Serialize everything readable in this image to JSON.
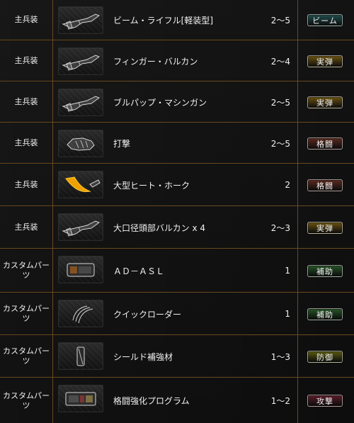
{
  "rows": [
    {
      "category": "主兵装",
      "name": "ビーム・ライフル[軽装型]",
      "range": "2～5",
      "type": "ビーム",
      "type_color": "#1f4d4c",
      "icon": "beam-rifle-icon"
    },
    {
      "category": "主兵装",
      "name": "フィンガー・バルカン",
      "range": "2～4",
      "type": "実弾",
      "type_color": "#6a5210",
      "icon": "finger-vulcan-icon"
    },
    {
      "category": "主兵装",
      "name": "ブルパップ・マシンガン",
      "range": "2～5",
      "type": "実弾",
      "type_color": "#6a5210",
      "icon": "bullpup-machine-gun-icon"
    },
    {
      "category": "主兵装",
      "name": "打撃",
      "range": "2～5",
      "type": "格闘",
      "type_color": "#5a2a1e",
      "icon": "fist-strike-icon"
    },
    {
      "category": "主兵装",
      "name": "大型ヒート・ホーク",
      "range": "2",
      "type": "格闘",
      "type_color": "#5a2a1e",
      "icon": "heat-hawk-icon"
    },
    {
      "category": "主兵装",
      "name": "大口径頭部バルカン x 4",
      "range": "2～3",
      "type": "実弾",
      "type_color": "#6a5210",
      "icon": "head-vulcan-icon"
    },
    {
      "category": "カスタムパーツ",
      "name": "ＡＤ－ＡＳＬ",
      "range": "1",
      "type": "補助",
      "type_color": "#285428",
      "icon": "ad-asl-part-icon"
    },
    {
      "category": "カスタムパーツ",
      "name": "クイックローダー",
      "range": "1",
      "type": "補助",
      "type_color": "#285428",
      "icon": "quick-loader-part-icon"
    },
    {
      "category": "カスタムパーツ",
      "name": "シールド補強材",
      "range": "1～3",
      "type": "防御",
      "type_color": "#5b5b14",
      "icon": "shield-reinforcement-part-icon"
    },
    {
      "category": "カスタムパーツ",
      "name": "格闘強化プログラム",
      "range": "1～2",
      "type": "攻撃",
      "type_color": "#5a1f2a",
      "icon": "melee-program-part-icon"
    }
  ],
  "colors": {
    "border": "#6b4a1f",
    "text": "#f2f2f2",
    "background": "#0c0c0c"
  }
}
